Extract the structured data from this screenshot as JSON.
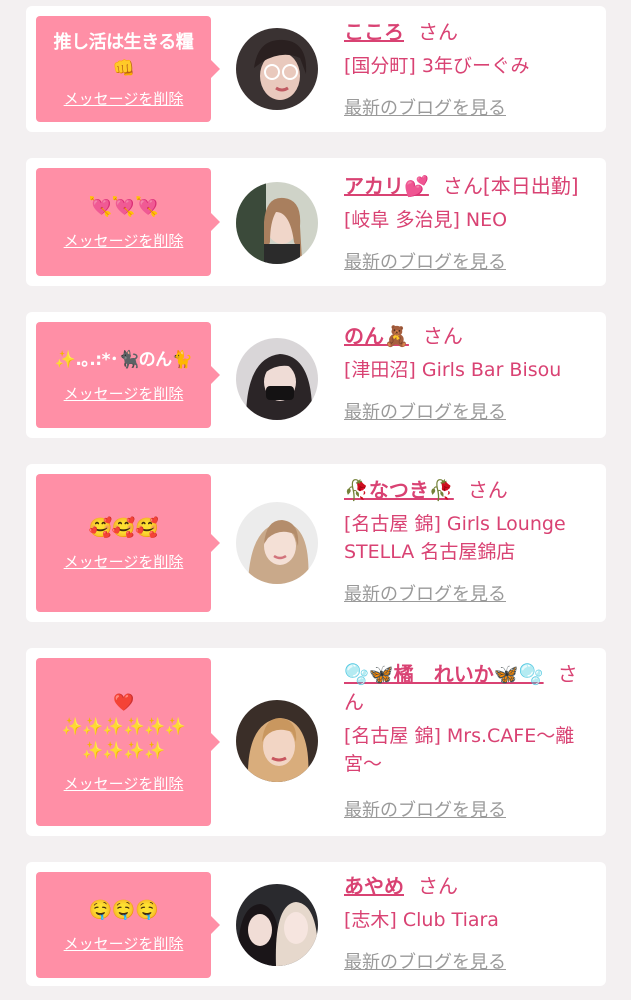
{
  "delete_label": "メッセージを削除",
  "blog_label": "最新のブログを見る",
  "honorific": "さん",
  "cards": [
    {
      "message": "推し活は生きる糧\n👊",
      "name": "こころ",
      "status": "",
      "shop": "[国分町] 3年びーぐみ"
    },
    {
      "message": "💘💘💘",
      "name": "アカリ💕",
      "status": "[本日出勤]",
      "shop": "[岐阜 多治見] NEO"
    },
    {
      "message": "✨.｡.:*･🐈‍⬛のん🐈",
      "name": "のん🧸",
      "status": "",
      "shop": "[津田沼] Girls Bar Bisou"
    },
    {
      "message": "🥰🥰🥰",
      "name": "🥀なつき🥀",
      "status": "",
      "shop": "[名古屋 錦] Girls Lounge STELLA 名古屋錦店"
    },
    {
      "message": "❤️\n✨✨✨✨✨✨\n✨✨✨✨",
      "name": "🫧🦋橘　れいか🦋🫧",
      "status": "",
      "shop": "[名古屋 錦] Mrs.CAFE〜離宮〜"
    },
    {
      "message": "🤤🤤🤤",
      "name": "あやめ",
      "status": "",
      "shop": "[志木] Club Tiara"
    }
  ],
  "colors": {
    "background": "#f3f0f1",
    "bubble": "#ff8fa6",
    "accent_text": "#d94273",
    "link_gray": "#9a9a9a"
  }
}
